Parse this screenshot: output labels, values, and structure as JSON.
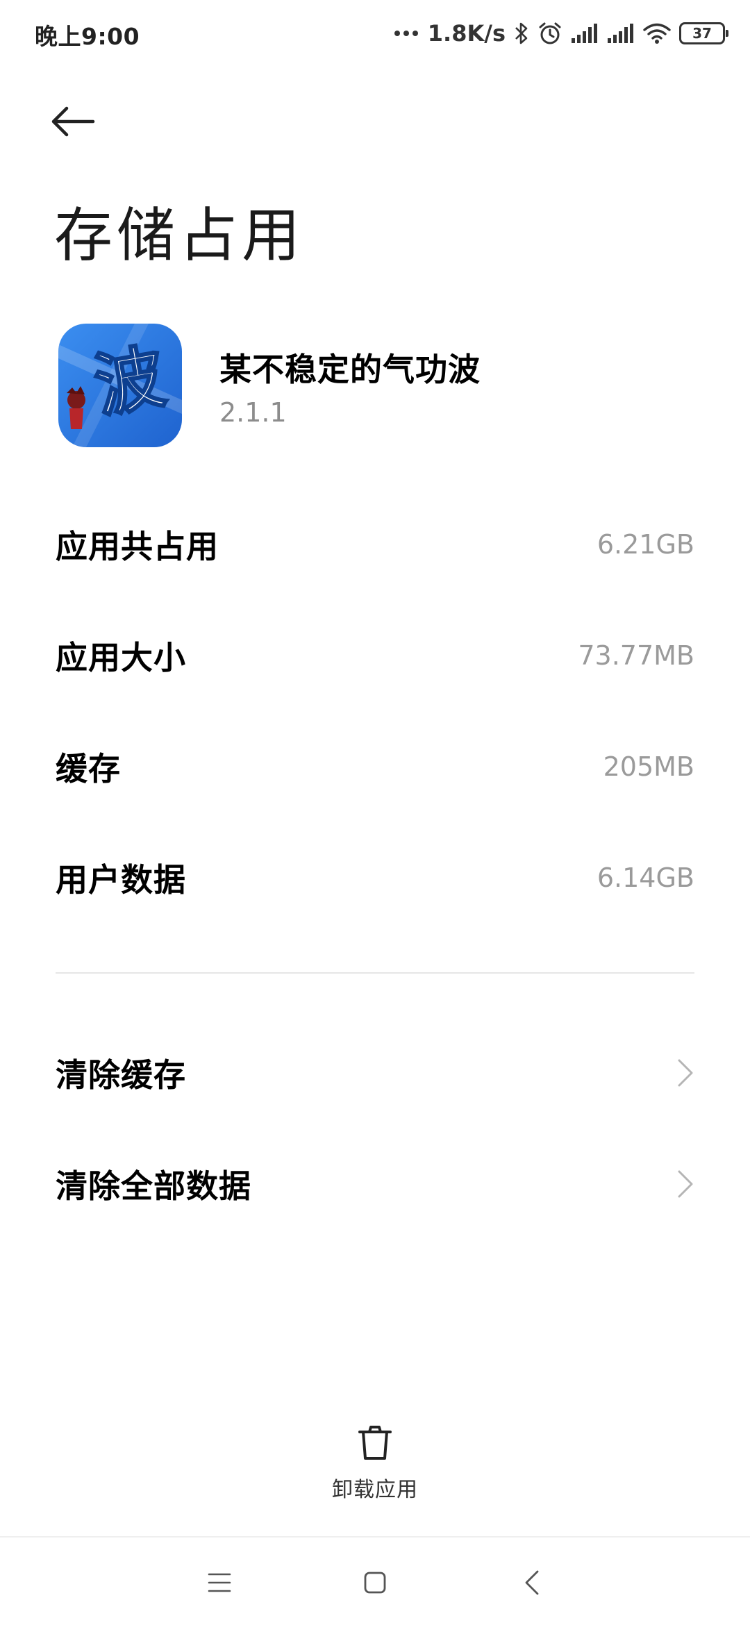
{
  "status_bar": {
    "time": "晚上9:00",
    "net_speed": "1.8K/s",
    "battery_level": "37",
    "icons": [
      "more-dots-icon",
      "bluetooth-icon",
      "alarm-icon",
      "signal-icon",
      "signal-icon",
      "wifi-icon",
      "battery-icon"
    ]
  },
  "header": {
    "back_icon": "arrow-left-icon",
    "title": "存储占用"
  },
  "app": {
    "name": "某不稳定的气功波",
    "version": "2.1.1",
    "icon_glyph": "波",
    "icon_color": "#2f7ee3"
  },
  "storage": {
    "items": [
      {
        "label": "应用共占用",
        "value": "6.21GB"
      },
      {
        "label": "应用大小",
        "value": "73.77MB"
      },
      {
        "label": "缓存",
        "value": "205MB"
      },
      {
        "label": "用户数据",
        "value": "6.14GB"
      }
    ]
  },
  "actions": {
    "items": [
      {
        "label": "清除缓存"
      },
      {
        "label": "清除全部数据"
      }
    ]
  },
  "uninstall": {
    "label": "卸载应用",
    "icon": "trash-icon"
  },
  "nav": {
    "buttons": [
      "menu-icon",
      "home-icon",
      "back-icon"
    ]
  }
}
